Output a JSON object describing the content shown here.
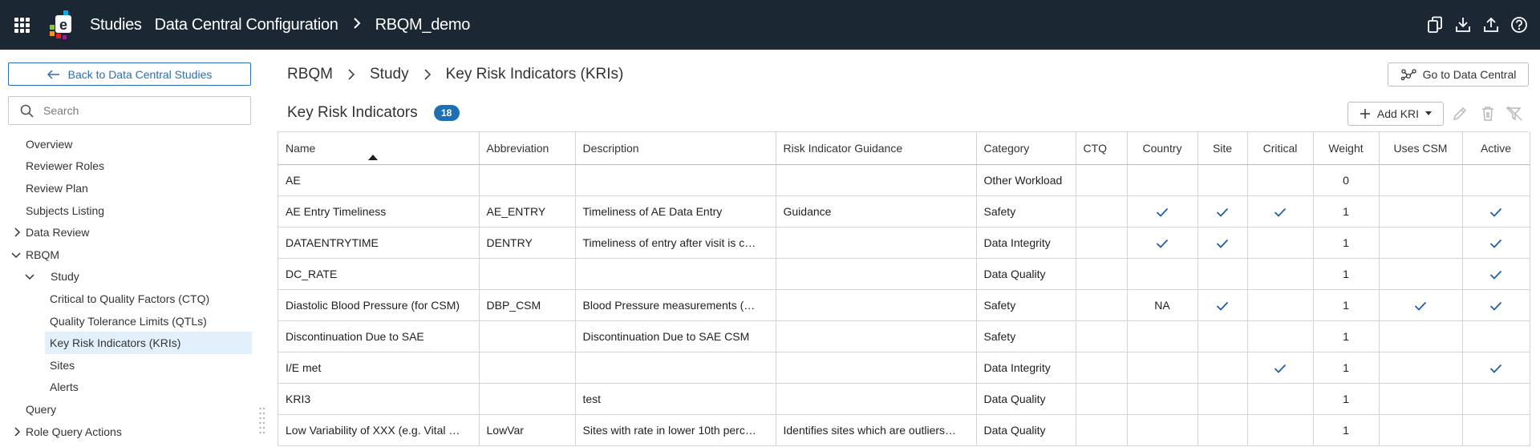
{
  "header": {
    "app_name": "Studies",
    "section": "Data Central Configuration",
    "current": "RBQM_demo",
    "icons": [
      "copy-icon",
      "download-icon",
      "upload-icon",
      "help-icon"
    ]
  },
  "sidebar": {
    "back_label": "Back to Data Central Studies",
    "search_placeholder": "Search",
    "items": [
      {
        "label": "Overview"
      },
      {
        "label": "Reviewer Roles"
      },
      {
        "label": "Review Plan"
      },
      {
        "label": "Subjects Listing"
      },
      {
        "label": "Data Review"
      },
      {
        "label": "RBQM"
      },
      {
        "label": "Study"
      },
      {
        "label": "Critical to Quality Factors (CTQ)"
      },
      {
        "label": "Quality Tolerance Limits (QTLs)"
      },
      {
        "label": "Key Risk Indicators (KRIs)"
      },
      {
        "label": "Sites"
      },
      {
        "label": "Alerts"
      },
      {
        "label": "Query"
      },
      {
        "label": "Role Query Actions"
      }
    ]
  },
  "breadcrumb": [
    "RBQM",
    "Study",
    "Key Risk Indicators (KRIs)"
  ],
  "goto_label": "Go to Data Central",
  "page": {
    "title": "Key Risk Indicators",
    "count": "18",
    "add_label": "Add KRI"
  },
  "table": {
    "columns": [
      "Name",
      "Abbreviation",
      "Description",
      "Risk Indicator Guidance",
      "Category",
      "CTQ",
      "Country",
      "Site",
      "Critical",
      "Weight",
      "Uses CSM",
      "Active"
    ],
    "check_mark": "✓",
    "rows": [
      {
        "name": "AE",
        "abbr": "",
        "desc": "",
        "guidance": "",
        "category": "Other Workload",
        "ctq": "",
        "country": "",
        "site": "",
        "critical": "",
        "weight": "0",
        "csm": "",
        "active": ""
      },
      {
        "name": "AE Entry Timeliness",
        "abbr": "AE_ENTRY",
        "desc": "Timeliness of AE Data Entry",
        "guidance": "Guidance",
        "category": "Safety",
        "ctq": "",
        "country": "check",
        "site": "check",
        "critical": "check",
        "weight": "1",
        "csm": "",
        "active": "check"
      },
      {
        "name": "DATAENTRYTIME",
        "abbr": "DENTRY",
        "desc": "Timeliness of entry after visit is c…",
        "guidance": "",
        "category": "Data Integrity",
        "ctq": "",
        "country": "check",
        "site": "check",
        "critical": "",
        "weight": "1",
        "csm": "",
        "active": "check"
      },
      {
        "name": "DC_RATE",
        "abbr": "",
        "desc": "",
        "guidance": "",
        "category": "Data Quality",
        "ctq": "",
        "country": "",
        "site": "",
        "critical": "",
        "weight": "1",
        "csm": "",
        "active": "check"
      },
      {
        "name": "Diastolic Blood Pressure (for CSM)",
        "abbr": "DBP_CSM",
        "desc": "Blood Pressure measurements (…",
        "guidance": "",
        "category": "Safety",
        "ctq": "",
        "country": "NA",
        "site": "check",
        "critical": "",
        "weight": "1",
        "csm": "check",
        "active": "check"
      },
      {
        "name": "Discontinuation Due to SAE",
        "abbr": "",
        "desc": "Discontinuation Due to SAE CSM",
        "guidance": "",
        "category": "Safety",
        "ctq": "",
        "country": "",
        "site": "",
        "critical": "",
        "weight": "1",
        "csm": "",
        "active": ""
      },
      {
        "name": "I/E met",
        "abbr": "",
        "desc": "",
        "guidance": "",
        "category": "Data Integrity",
        "ctq": "",
        "country": "",
        "site": "",
        "critical": "check",
        "weight": "1",
        "csm": "",
        "active": "check"
      },
      {
        "name": "KRI3",
        "abbr": "",
        "desc": "test",
        "guidance": "",
        "category": "Data Quality",
        "ctq": "",
        "country": "",
        "site": "",
        "critical": "",
        "weight": "1",
        "csm": "",
        "active": ""
      },
      {
        "name": "Low Variability of XXX (e.g. Vital …",
        "abbr": "LowVar",
        "desc": "Sites with rate in lower 10th perc…",
        "guidance": "Identifies sites which are outliers…",
        "category": "Data Quality",
        "ctq": "",
        "country": "",
        "site": "",
        "critical": "",
        "weight": "1",
        "csm": "",
        "active": ""
      }
    ]
  },
  "colors": {
    "topbar": "#1c2734",
    "accent": "#2a6fb1",
    "badge": "#1f6fb4",
    "selected_nav": "#e2f0fc",
    "check": "#1f5fa8"
  }
}
